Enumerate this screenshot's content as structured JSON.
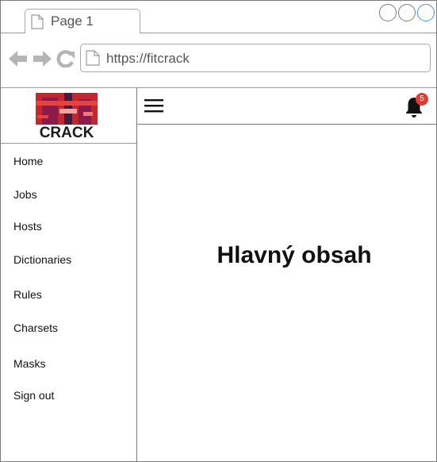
{
  "browser": {
    "tab_title": "Page 1",
    "url": "https://fitcrack"
  },
  "logo": {
    "text": "CRACK",
    "colors": [
      "#c1272d",
      "#8b1a4a",
      "#e8423f",
      "#4a1a3a"
    ]
  },
  "sidebar": {
    "items": [
      {
        "label": "Home"
      },
      {
        "label": "Jobs"
      },
      {
        "label": "Hosts"
      },
      {
        "label": "Dictionaries"
      },
      {
        "label": "Rules"
      },
      {
        "label": "Charsets"
      },
      {
        "label": "Masks"
      },
      {
        "label": "Sign out"
      }
    ]
  },
  "topbar": {
    "menu_icon": "hamburger-icon",
    "notification_icon": "bell-icon",
    "notification_count": "5",
    "badge_color": "#e53935"
  },
  "main": {
    "title": "Hlavný obsah"
  }
}
